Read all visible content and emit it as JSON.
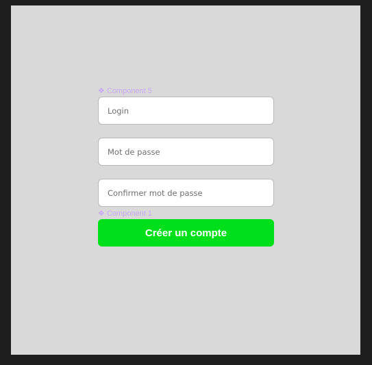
{
  "colors": {
    "background_outer": "#1e1e1e",
    "canvas": "#d9d9d9",
    "component_label": "#c9a6f2",
    "button": "#00e01a",
    "button_text": "#ffffff"
  },
  "form": {
    "component_label_top": "Component 5",
    "login": {
      "placeholder": "Login",
      "value": ""
    },
    "password": {
      "placeholder": "Mot de passe",
      "value": ""
    },
    "confirm_password": {
      "placeholder": "Confirmer mot de passe",
      "value": ""
    },
    "component_label_bottom": "Component 1",
    "submit_label": "Créer un compte"
  },
  "icons": {
    "component": "component-icon"
  }
}
